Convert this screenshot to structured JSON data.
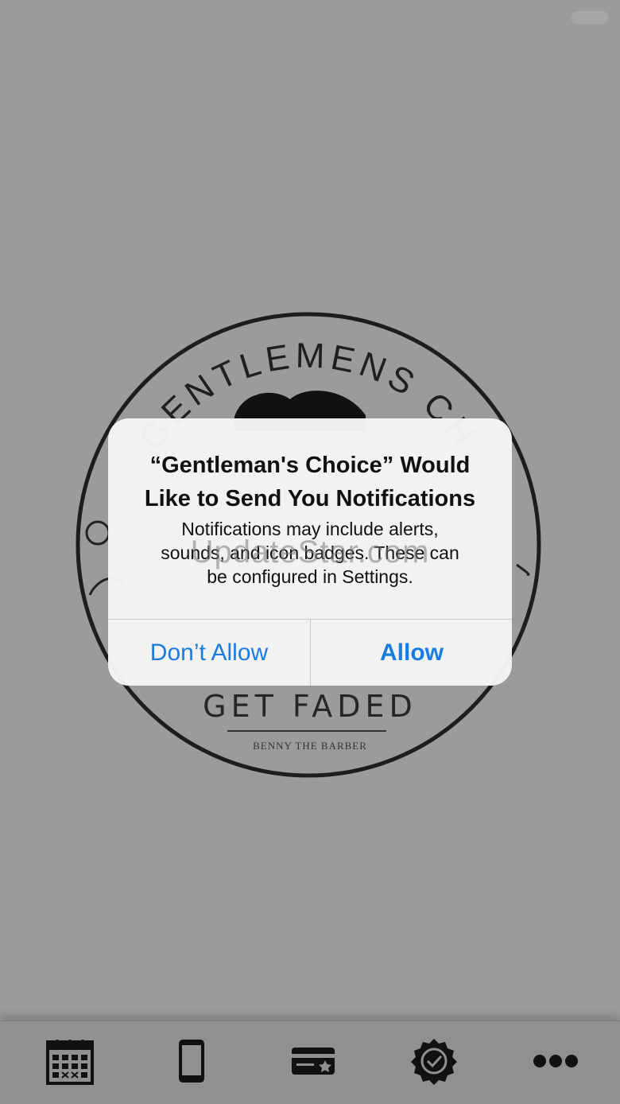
{
  "logo": {
    "arc_text": "GENTLEMENS CH",
    "slogan": "GET FADED",
    "tagline": "BENNY THE BARBER"
  },
  "alert": {
    "title_line1": "“Gentleman's Choice” Would",
    "title_line2": "Like to Send You Notifications",
    "message_line1": "Notifications may include alerts,",
    "message_line2": "sounds, and icon badges. These can",
    "message_line3": "be configured in Settings.",
    "dont_allow": "Don’t Allow",
    "allow": "Allow",
    "accent_color": "#1b7ce0"
  },
  "watermark": "UpdateStar.com",
  "tabbar": {
    "items": [
      {
        "icon": "calendar-icon"
      },
      {
        "icon": "phone-icon"
      },
      {
        "icon": "card-star-icon"
      },
      {
        "icon": "badge-check-icon"
      },
      {
        "icon": "more-dots-icon"
      }
    ]
  }
}
